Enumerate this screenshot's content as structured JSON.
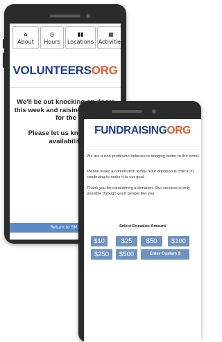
{
  "volunteers_app": {
    "nav": [
      {
        "icon": "home-icon",
        "glyph": "⌂",
        "label": "About"
      },
      {
        "icon": "clock-icon",
        "glyph": "◷",
        "label": "Hours"
      },
      {
        "icon": "map-icon",
        "glyph": "▮▮",
        "label": "Locations"
      },
      {
        "icon": "calendar-icon",
        "glyph": "▦",
        "label": "Activities"
      }
    ],
    "logo": {
      "part1": "VOLUNTEERS",
      "part2": "ORG"
    },
    "message1": "We'll be out knocking on doors this week and raising awareness for the",
    "message2": "Please let us know your availability",
    "return_button": "Return to SMS"
  },
  "fundraising_app": {
    "logo": {
      "part1": "FUNDRAISING",
      "part2": "ORG"
    },
    "paragraphs": [
      "We are a non-profit who believes in bringing better to the world.",
      "Please make a contribution today. Your donation is critical in continuing to make it to our goal.",
      "Thank you for considering a donation. Our success is only possible through good people like you."
    ],
    "select_title": "Select Donation Amount",
    "amounts": [
      "$10",
      "$25",
      "$50",
      "$100",
      "$250",
      "$500"
    ],
    "custom_button": "Enter Custom $"
  },
  "colors": {
    "logo_blue": "#1e3c8f",
    "logo_orange": "#e5582a",
    "button_blue": "#6f93bf",
    "return_blue": "#5b8ac7"
  }
}
